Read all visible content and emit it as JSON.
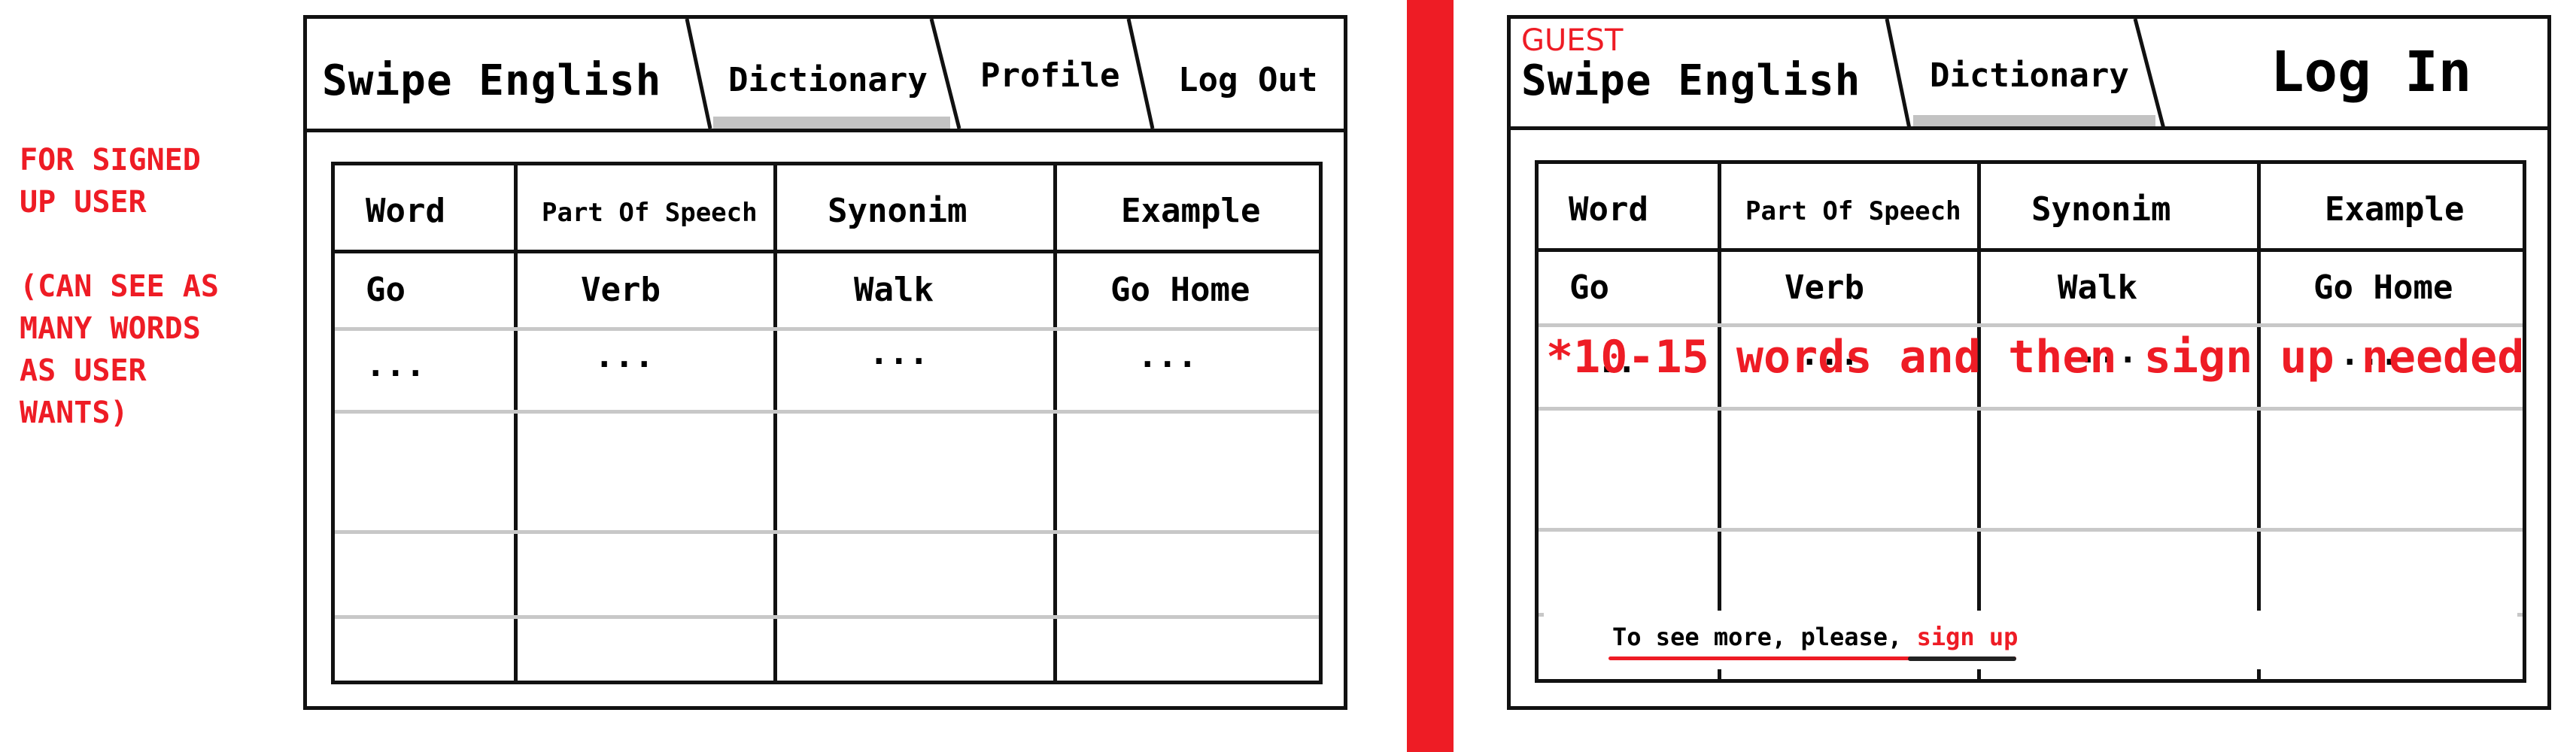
{
  "note": {
    "text": "FOR SIGNED\nUP USER\n\n(CAN SEE AS\nMANY WORDS\nAS USER\nWANTS)"
  },
  "signed_in_view": {
    "app_title": "Swipe English",
    "tabs": [
      {
        "label": "Dictionary",
        "active": true
      },
      {
        "label": "Profile"
      },
      {
        "label": "Log Out"
      }
    ],
    "table": {
      "headers": [
        "Word",
        "Part Of Speech",
        "Synonim",
        "Example"
      ],
      "rows": [
        [
          "Go",
          "Verb",
          "Walk",
          "Go Home"
        ],
        [
          "...",
          "...",
          "...",
          "..."
        ]
      ]
    }
  },
  "guest_view": {
    "guest_label": "GUEST",
    "app_title": "Swipe English",
    "tabs": [
      {
        "label": "Dictionary",
        "active": true
      }
    ],
    "login_label": "Log In",
    "table": {
      "headers": [
        "Word",
        "Part Of Speech",
        "Synonim",
        "Example"
      ],
      "rows": [
        [
          "Go",
          "Verb",
          "Walk",
          "Go Home"
        ],
        [
          "...",
          "...",
          "...",
          "..."
        ]
      ]
    },
    "limit_note": "*10-15 words and then sign up needed",
    "footer": {
      "prefix": "To see more, please, ",
      "link": "sign up"
    }
  },
  "colors": {
    "accent": "#ee1c25",
    "tab_underline": "#c3c3c3",
    "grid_light": "#c8c8c8"
  }
}
